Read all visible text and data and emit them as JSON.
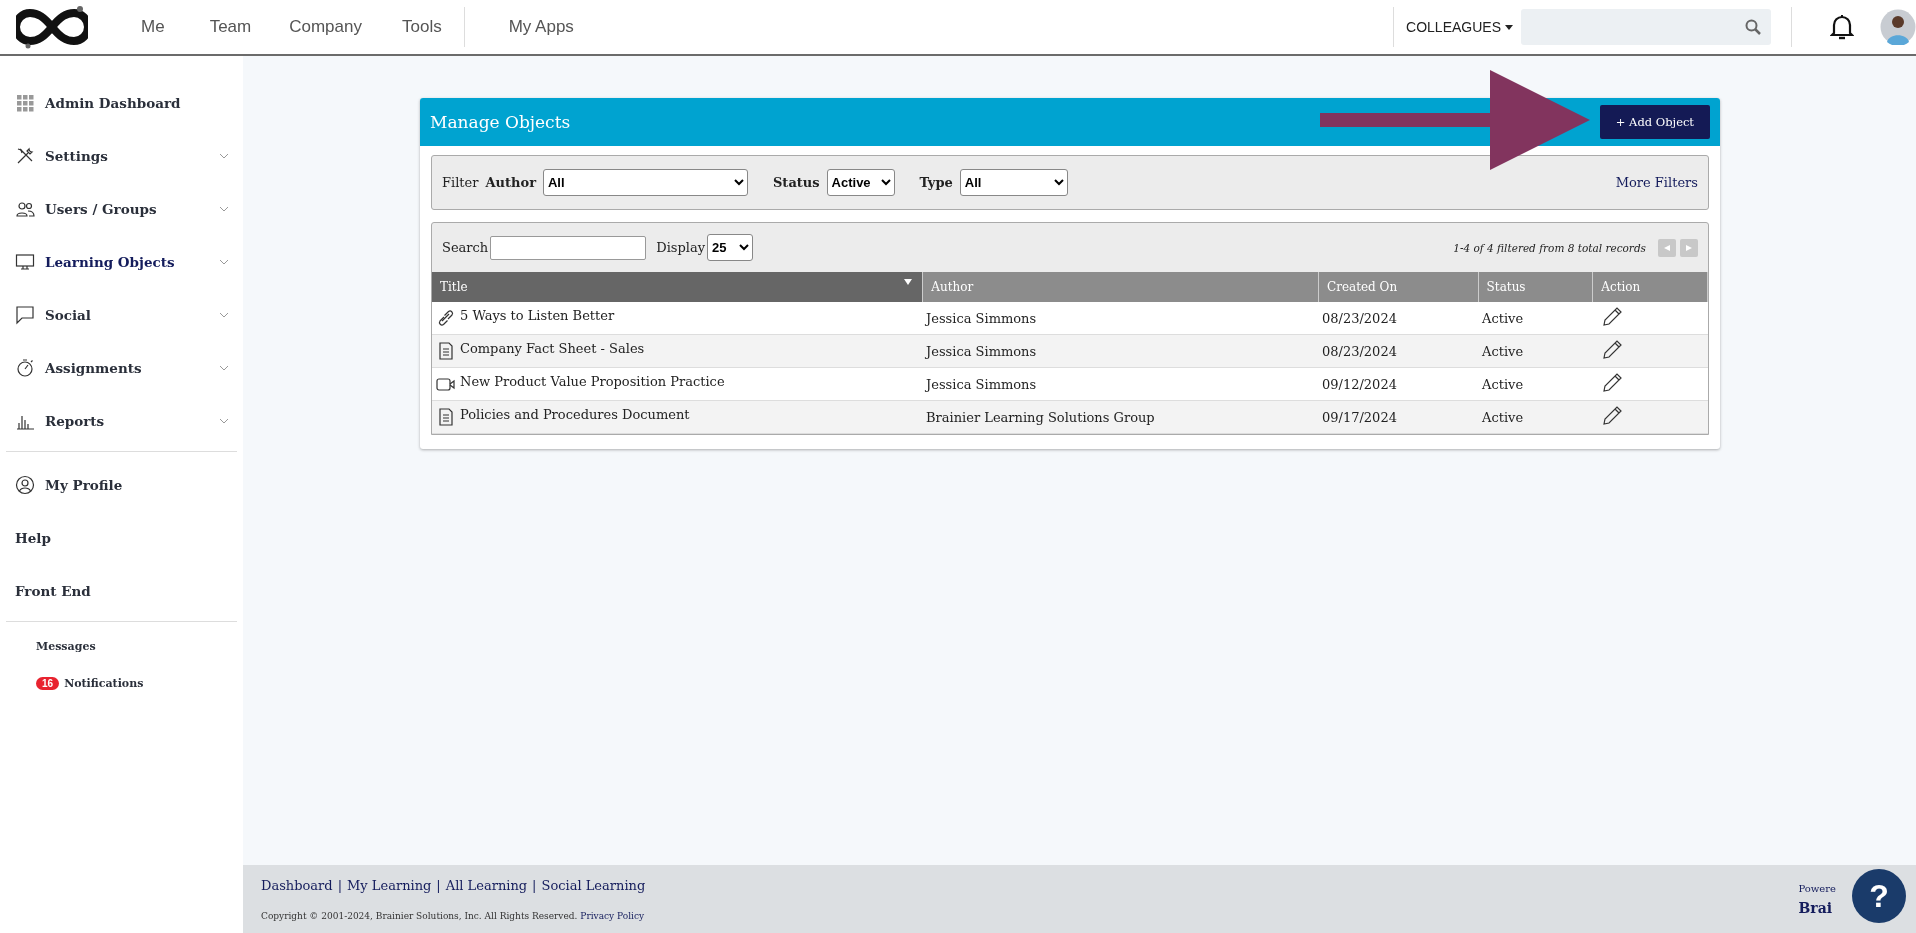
{
  "top_nav": {
    "items": [
      {
        "label": "Me"
      },
      {
        "label": "Team"
      },
      {
        "label": "Company"
      },
      {
        "label": "Tools"
      },
      {
        "label": "My Apps"
      }
    ],
    "colleagues": "COLLEAGUES"
  },
  "sidebar": {
    "sections": [
      {
        "items": [
          {
            "label": "Admin Dashboard",
            "has_submenu": false,
            "selected": false
          },
          {
            "label": "Settings",
            "has_submenu": true,
            "selected": false
          },
          {
            "label": "Users / Groups",
            "has_submenu": true,
            "selected": false
          },
          {
            "label": "Learning Objects",
            "has_submenu": true,
            "selected": true
          },
          {
            "label": "Social",
            "has_submenu": true,
            "selected": false
          },
          {
            "label": "Assignments",
            "has_submenu": true,
            "selected": false
          },
          {
            "label": "Reports",
            "has_submenu": true,
            "selected": false
          }
        ]
      },
      {
        "items": [
          {
            "label": "My Profile",
            "has_submenu": false,
            "selected": false
          },
          {
            "label": "Help",
            "has_submenu": false,
            "selected": false
          },
          {
            "label": "Front End",
            "has_submenu": false,
            "selected": false
          }
        ]
      }
    ],
    "small_items": [
      {
        "label": "Messages"
      },
      {
        "label": "Notifications",
        "badge": "16"
      }
    ]
  },
  "panel": {
    "title": "Manage Objects",
    "add_button": "+ Add Object",
    "filters": {
      "label": "Filter",
      "fields": [
        {
          "label": "Author",
          "value": "All"
        },
        {
          "label": "Status",
          "value": "Active"
        },
        {
          "label": "Type",
          "value": "All"
        }
      ],
      "more": "More Filters"
    },
    "search_label": "Search",
    "display_label": "Display",
    "display_value": "25",
    "records": "1-4 of 4 filtered from 8 total records",
    "table": {
      "columns": [
        {
          "label": "Title",
          "sorted": true
        },
        {
          "label": "Author",
          "sorted": false
        },
        {
          "label": "Created On",
          "sorted": false
        },
        {
          "label": "Status",
          "sorted": false
        },
        {
          "label": "Action",
          "sorted": false
        }
      ],
      "rows": [
        {
          "kind": "link",
          "title": "5 Ways to Listen Better",
          "author": "Jessica Simmons",
          "created": "08/23/2024",
          "status": "Active"
        },
        {
          "kind": "document",
          "title": "Company Fact Sheet - Sales",
          "author": "Jessica Simmons",
          "created": "08/23/2024",
          "status": "Active"
        },
        {
          "kind": "video",
          "title": "New Product Value Proposition Practice",
          "author": "Jessica Simmons",
          "created": "09/12/2024",
          "status": "Active"
        },
        {
          "kind": "document",
          "title": "Policies and Procedures Document",
          "author": "Brainier Learning Solutions Group",
          "created": "09/17/2024",
          "status": "Active"
        }
      ]
    }
  },
  "footer": {
    "links": [
      {
        "label": "Dashboard"
      },
      {
        "label": "My Learning"
      },
      {
        "label": "All Learning"
      },
      {
        "label": "Social Learning"
      }
    ],
    "separator": "|",
    "copyright": "Copyright © 2001-2024, Brainier Solutions, Inc. All Rights Reserved.",
    "privacy": "Privacy Policy",
    "powered": "Powere",
    "brand": "Brai",
    "help": "?"
  }
}
